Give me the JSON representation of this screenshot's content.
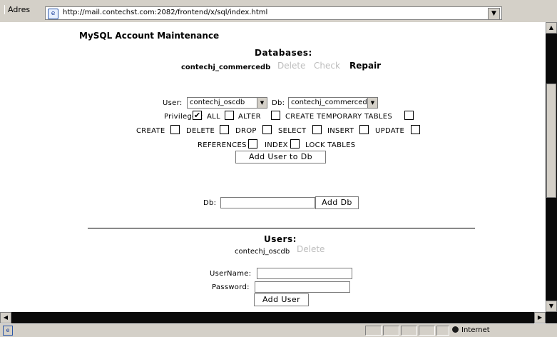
{
  "browser": {
    "address_label": "Adres",
    "url": "http://mail.contechst.com:2082/frontend/x/sql/index.html",
    "status_zone": "Internet"
  },
  "page": {
    "title": "MySQL Account Maintenance",
    "databases": {
      "heading": "Databases:",
      "db_name": "contechj_commercedb",
      "delete_label": "Delete",
      "check_label": "Check",
      "repair_label": "Repair"
    },
    "add_user_to_db": {
      "user_label": "User:",
      "user_value": "contechj_oscdb",
      "db_label": "Db:",
      "db_value": "contechj_commercedb",
      "privileges_label": "Privileges:",
      "privileges": {
        "all": {
          "label": "ALL",
          "checked": true
        },
        "alter": {
          "label": "ALTER",
          "checked": false
        },
        "create_temporary_tables": {
          "label": "CREATE TEMPORARY TABLES",
          "checked": false
        },
        "create": {
          "label": "CREATE",
          "checked": false
        },
        "delete": {
          "label": "DELETE",
          "checked": false
        },
        "drop": {
          "label": "DROP",
          "checked": false
        },
        "select": {
          "label": "SELECT",
          "checked": false
        },
        "insert": {
          "label": "INSERT",
          "checked": false
        },
        "update": {
          "label": "UPDATE",
          "checked": false
        },
        "references": {
          "label": "REFERENCES",
          "checked": false
        },
        "index": {
          "label": "INDEX",
          "checked": false
        },
        "lock_tables": {
          "label": "LOCK TABLES",
          "checked": false
        }
      },
      "button": "Add User to Db"
    },
    "add_db": {
      "db_label": "Db:",
      "db_value": "",
      "button": "Add Db"
    },
    "users": {
      "heading": "Users:",
      "user_name": "contechj_oscdb",
      "delete_label": "Delete"
    },
    "add_user": {
      "username_label": "UserName:",
      "username_value": "",
      "password_label": "Password:",
      "password_value": "",
      "button": "Add User"
    }
  }
}
